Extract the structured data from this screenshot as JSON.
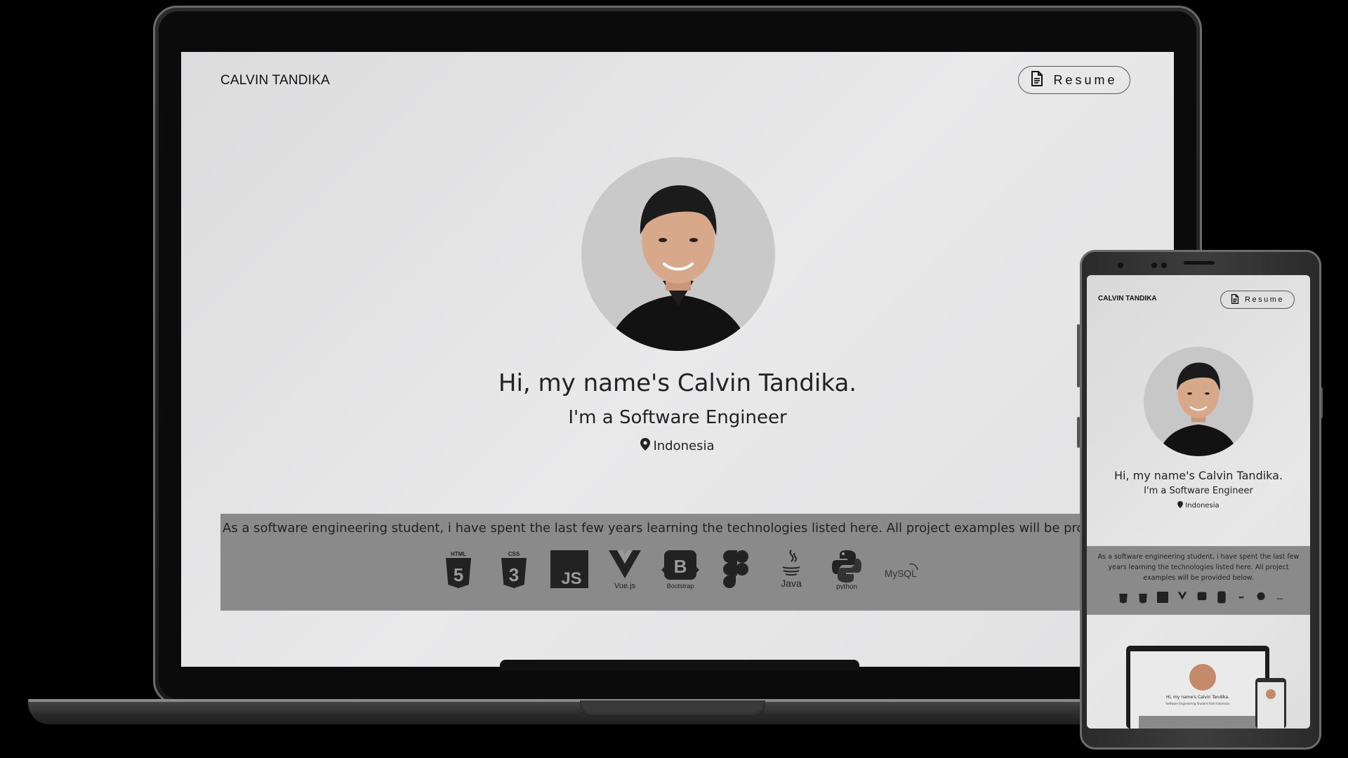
{
  "site": {
    "brand": "CALVIN TANDIKA",
    "resume_label": "Resume",
    "greeting": "Hi, my name's Calvin Tandika.",
    "role": "I'm a Software Engineer",
    "location": "Indonesia",
    "intro_laptop": "As a software engineering student, i have spent the last few years learning the technologies listed here. All project examples will be provided below.",
    "intro_phone": "As a software engineering student, i have spent the last few years learning the technologies listed here. All project examples will be provided below."
  },
  "technologies": [
    {
      "name": "html5-icon",
      "label": "HTML"
    },
    {
      "name": "css3-icon",
      "label": "CSS"
    },
    {
      "name": "javascript-icon",
      "label": "JS"
    },
    {
      "name": "vuejs-icon",
      "label": "Vue.js"
    },
    {
      "name": "bootstrap-icon",
      "label": "Bootstrap"
    },
    {
      "name": "figma-icon",
      "label": ""
    },
    {
      "name": "java-icon",
      "label": "Java"
    },
    {
      "name": "python-icon",
      "label": "python"
    },
    {
      "name": "mysql-icon",
      "label": "MySQL"
    }
  ],
  "mini_preview": {
    "greeting": "Hi, my name's Calvin Tandika.",
    "subtitle": "Software Engineering Student from Indonesia"
  },
  "colors": {
    "page_bg": "#e6e6e7",
    "band_bg": "#8a8a8a",
    "text": "#222222",
    "device_frame": "#2b2b2b"
  }
}
